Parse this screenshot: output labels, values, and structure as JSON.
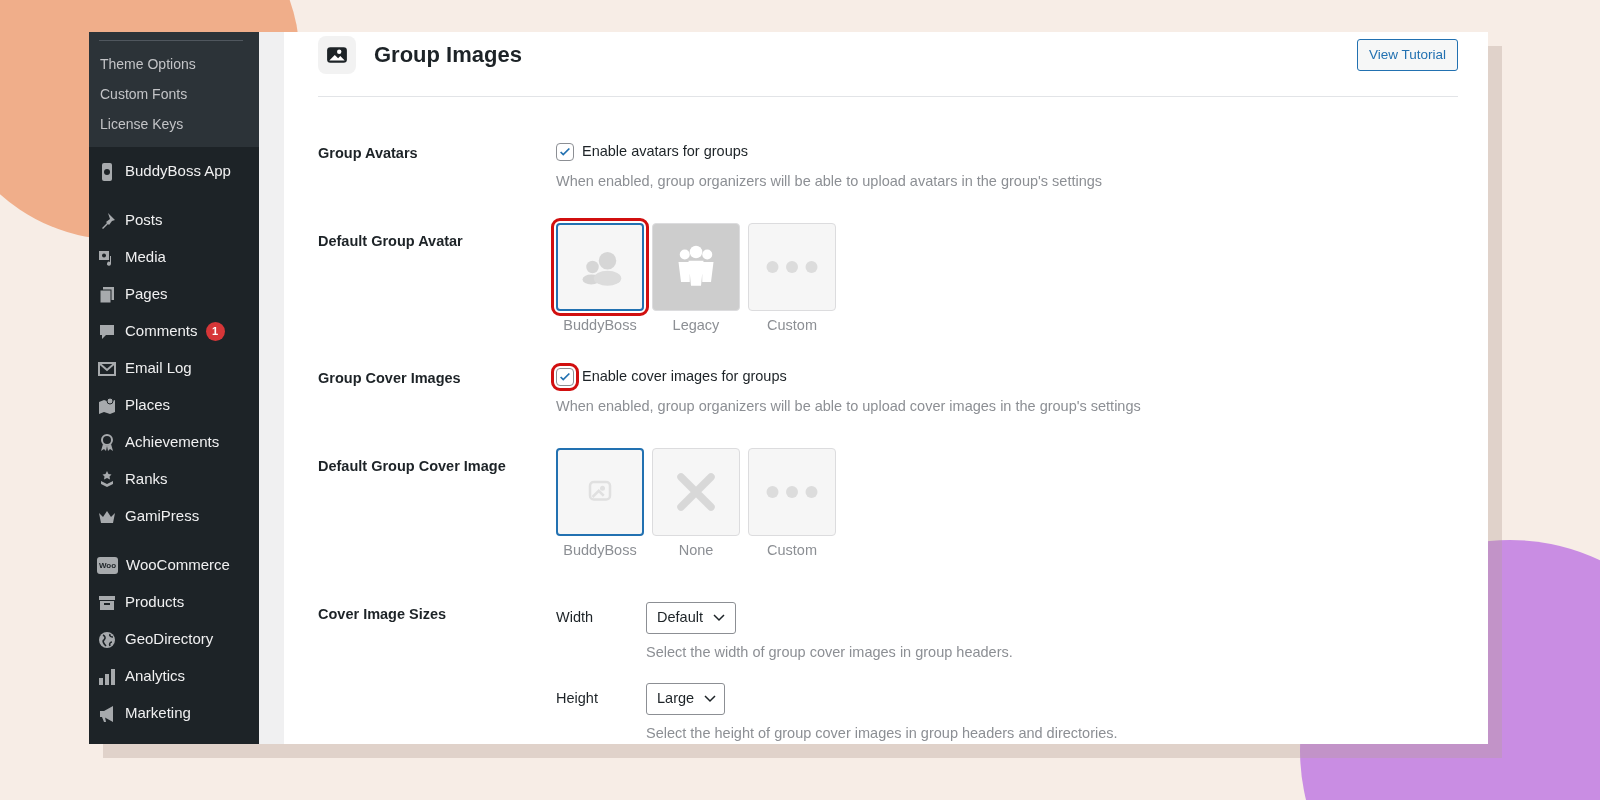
{
  "sidebar": {
    "submenu": [
      {
        "label": "Theme Options"
      },
      {
        "label": "Custom Fonts"
      },
      {
        "label": "License Keys"
      }
    ],
    "sections": [
      [
        {
          "label": "BuddyBoss App"
        }
      ],
      [
        {
          "label": "Posts"
        },
        {
          "label": "Media"
        },
        {
          "label": "Pages"
        },
        {
          "label": "Comments",
          "badge": "1"
        },
        {
          "label": "Email Log"
        },
        {
          "label": "Places"
        },
        {
          "label": "Achievements"
        },
        {
          "label": "Ranks"
        },
        {
          "label": "GamiPress"
        }
      ],
      [
        {
          "label": "WooCommerce"
        },
        {
          "label": "Products"
        },
        {
          "label": "GeoDirectory"
        },
        {
          "label": "Analytics"
        },
        {
          "label": "Marketing"
        }
      ]
    ]
  },
  "woo_icon_text": "Woo",
  "header": {
    "title": "Group Images",
    "button": "View Tutorial"
  },
  "settings": [
    {
      "kind": "checkbox",
      "label": "Group Avatars",
      "checkbox_label": "Enable avatars for groups",
      "checked": true,
      "highlighted": false,
      "description": "When enabled, group organizers will be able to upload avatars in the group's settings"
    },
    {
      "kind": "tiles",
      "label": "Default Group Avatar",
      "tiles": [
        {
          "kind": "people",
          "caption": "BuddyBoss",
          "selected": true,
          "highlighted": true
        },
        {
          "kind": "legacy",
          "caption": "Legacy",
          "selected": false,
          "highlighted": false
        },
        {
          "kind": "dots",
          "caption": "Custom",
          "selected": false,
          "highlighted": false
        }
      ]
    },
    {
      "kind": "checkbox",
      "label": "Group Cover Images",
      "checkbox_label": "Enable cover images for groups",
      "checked": true,
      "highlighted": true,
      "description": "When enabled, group organizers will be able to upload cover images in the group's settings"
    },
    {
      "kind": "tiles",
      "label": "Default Group Cover Image",
      "tiles": [
        {
          "kind": "pattern",
          "caption": "BuddyBoss",
          "selected": true,
          "highlighted": false
        },
        {
          "kind": "cross",
          "caption": "None",
          "selected": false,
          "highlighted": false
        },
        {
          "kind": "dots",
          "caption": "Custom",
          "selected": false,
          "highlighted": false
        }
      ]
    },
    {
      "kind": "sizes",
      "label": "Cover Image Sizes",
      "fields": [
        {
          "label": "Width",
          "value": "Default",
          "description": "Select the width of group cover images in group headers."
        },
        {
          "label": "Height",
          "value": "Large",
          "description": "Select the height of group cover images in group headers and directories."
        }
      ]
    }
  ]
}
